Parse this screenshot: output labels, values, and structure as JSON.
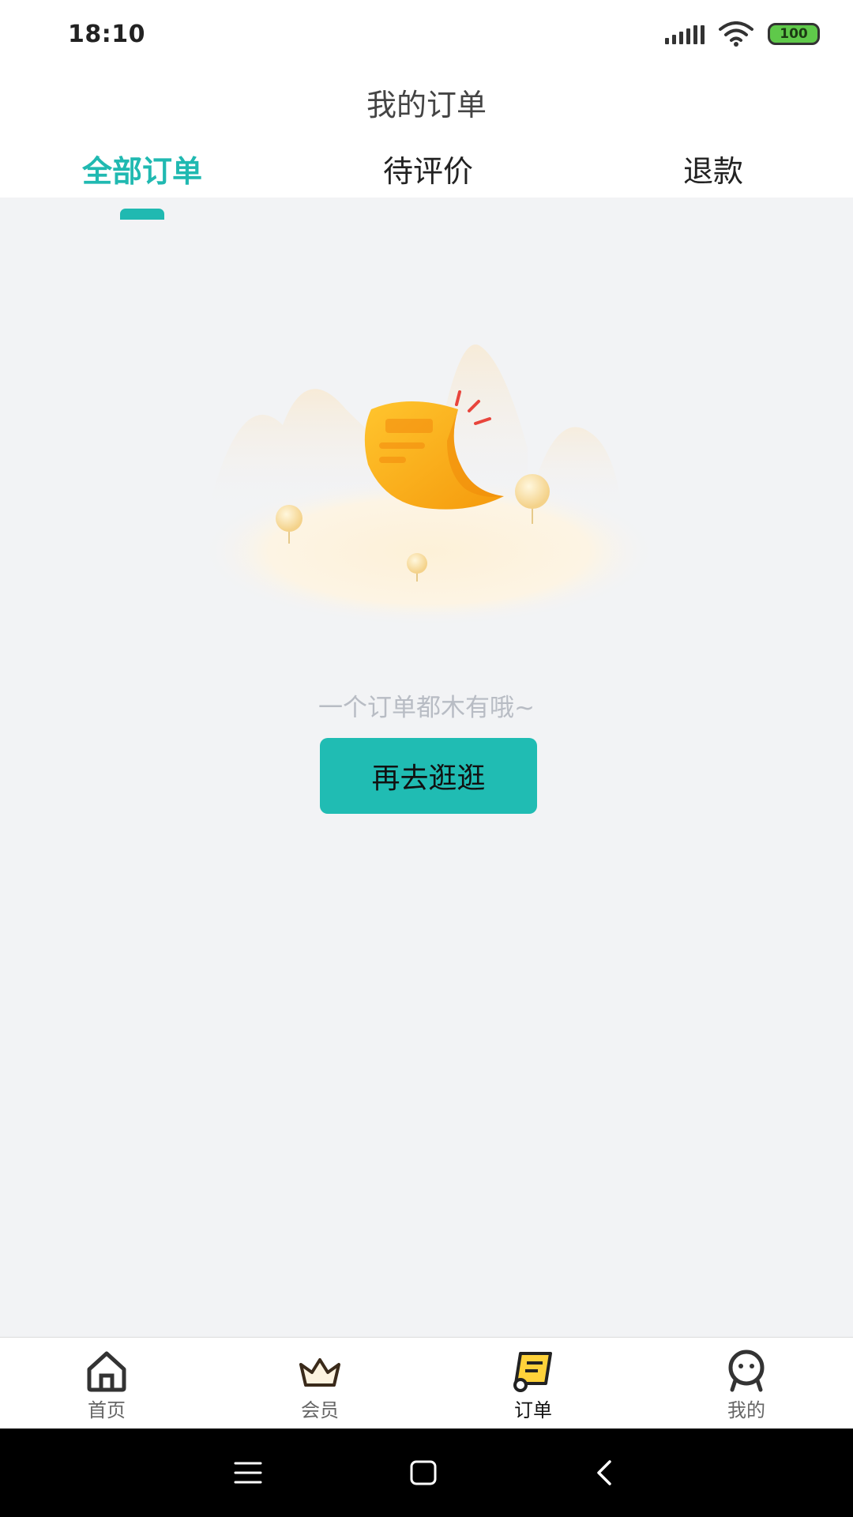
{
  "status_bar": {
    "time": "18:10",
    "battery": "100",
    "icons": [
      "signal-icon",
      "wifi-icon",
      "battery-icon"
    ]
  },
  "header": {
    "title": "我的订单",
    "tabs": [
      {
        "label": "全部订单",
        "active": true
      },
      {
        "label": "待评价",
        "active": false
      },
      {
        "label": "退款",
        "active": false
      }
    ]
  },
  "empty_state": {
    "message": "一个订单都木有哦~",
    "button_label": "再去逛逛",
    "illustration": "empty-order-illustration"
  },
  "bottom_nav": {
    "items": [
      {
        "label": "首页",
        "icon": "home-icon",
        "active": false
      },
      {
        "label": "会员",
        "icon": "crown-icon",
        "active": false
      },
      {
        "label": "订单",
        "icon": "order-icon",
        "active": true
      },
      {
        "label": "我的",
        "icon": "profile-icon",
        "active": false
      }
    ]
  },
  "system_nav": {
    "buttons": [
      "menu-icon",
      "home-square-icon",
      "back-icon"
    ]
  },
  "colors": {
    "accent": "#20b9b1",
    "background": "#f2f3f5",
    "illustration_orange": "#f7a81b"
  }
}
